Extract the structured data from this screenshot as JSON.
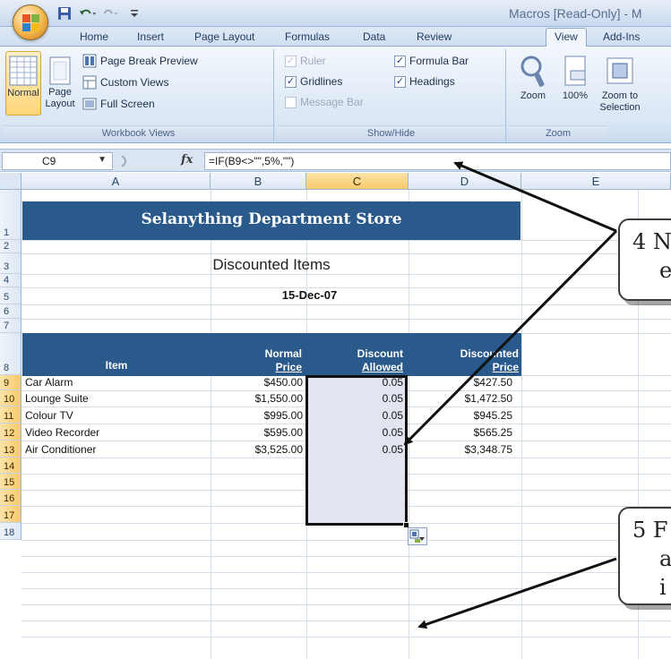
{
  "window": {
    "title": "Macros [Read-Only] - M"
  },
  "ribbon": {
    "tabs": [
      "Home",
      "Insert",
      "Page Layout",
      "Formulas",
      "Data",
      "Review",
      "View",
      "Add-Ins"
    ],
    "active_tab": "View",
    "groups": {
      "workbook_views": {
        "label": "Workbook Views",
        "normal": "Normal",
        "page_layout_line1": "Page",
        "page_layout_line2": "Layout",
        "page_break_preview": "Page Break Preview",
        "custom_views": "Custom Views",
        "full_screen": "Full Screen"
      },
      "show_hide": {
        "label": "Show/Hide",
        "ruler": "Ruler",
        "gridlines": "Gridlines",
        "message_bar": "Message Bar",
        "formula_bar": "Formula Bar",
        "headings": "Headings"
      },
      "zoom": {
        "label": "Zoom",
        "zoom": "Zoom",
        "hundred": "100%",
        "zoom_to_selection_line1": "Zoom to",
        "zoom_to_selection_line2": "Selection",
        "hundred_icon_text": "100"
      }
    }
  },
  "formula_bar": {
    "name_box": "C9",
    "fx": "fx",
    "formula": "=IF(B9<>\"\",5%,\"\")"
  },
  "sheet": {
    "columns": [
      "A",
      "B",
      "C",
      "D",
      "E"
    ],
    "rows": [
      "1",
      "2",
      "3",
      "4",
      "5",
      "6",
      "7",
      "8",
      "9",
      "10",
      "11",
      "12",
      "13",
      "14",
      "15",
      "16",
      "17",
      "18"
    ],
    "banner": "Selanything Department Store",
    "subtitle": "Discounted Items",
    "date": "15-Dec-07",
    "headers": {
      "item": "Item",
      "normal_price_line1": "Normal",
      "normal_price_line2": "Price",
      "discount_line1": "Discount",
      "discount_line2": "Allowed",
      "discounted_line1": "Discounted",
      "discounted_line2": "Price"
    },
    "items": [
      {
        "item": "Car Alarm",
        "price": "$450.00",
        "discount": "0.05",
        "discounted": "$427.50"
      },
      {
        "item": "Lounge Suite",
        "price": "$1,550.00",
        "discount": "0.05",
        "discounted": "$1,472.50"
      },
      {
        "item": "Colour TV",
        "price": "$995.00",
        "discount": "0.05",
        "discounted": "$945.25"
      },
      {
        "item": "Video Recorder",
        "price": "$595.00",
        "discount": "0.05",
        "discounted": "$565.25"
      },
      {
        "item": "Air Conditioner",
        "price": "$3,525.00",
        "discount": "0.05",
        "discounted": "$3,348.75"
      }
    ]
  },
  "callouts": {
    "c4_line1": "4 N",
    "c4_line2": "e",
    "c5_line1": "5 F",
    "c5_line2": "a",
    "c5_line3": "i"
  },
  "colors": {
    "banner": "#2a5a8c",
    "selection_fill": "#e2e5f0",
    "header_highlight": "#f7c96b"
  }
}
